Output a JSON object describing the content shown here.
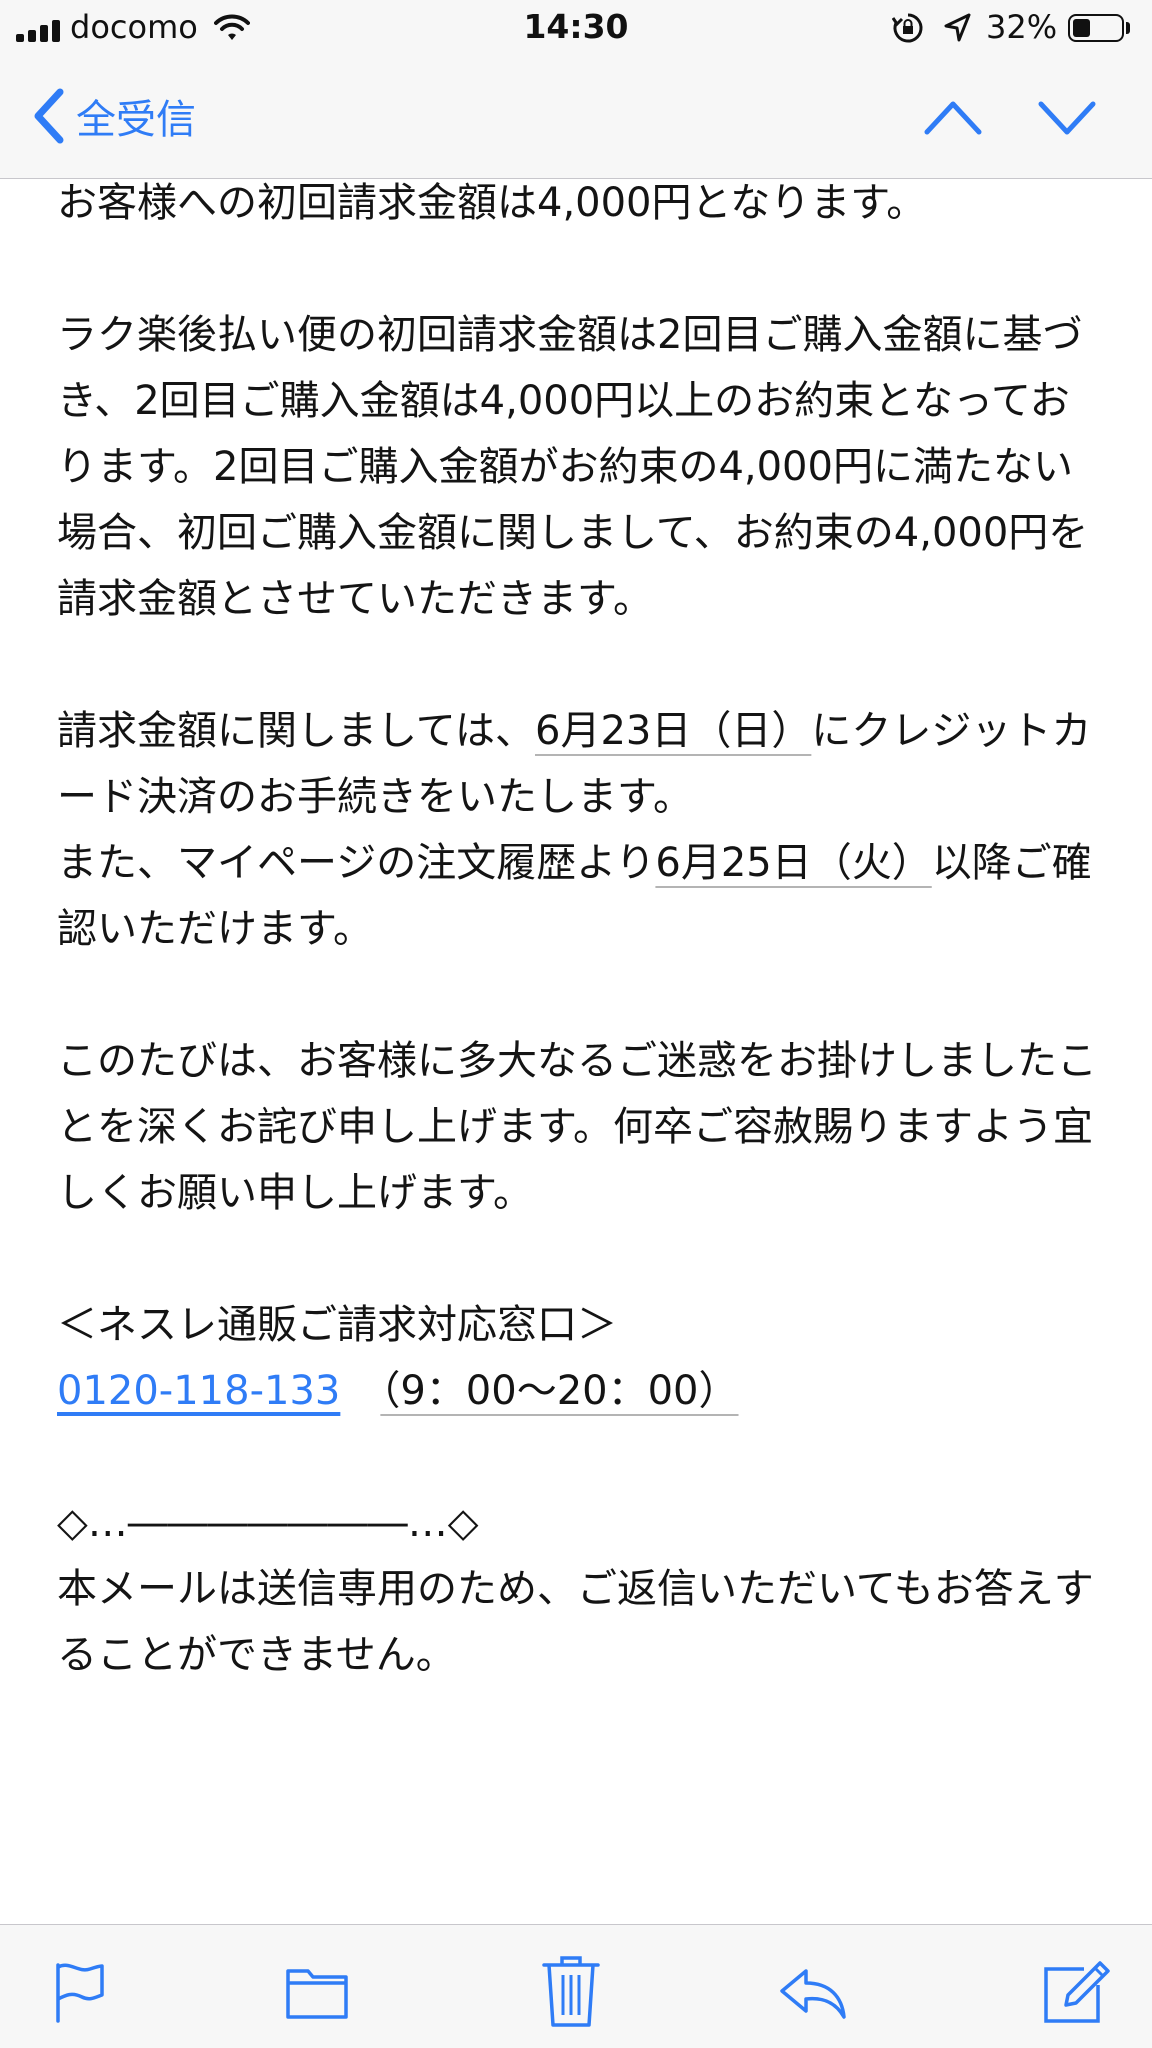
{
  "status_bar": {
    "carrier": "docomo",
    "time": "14:30",
    "battery": "32%",
    "battery_level": 0.32
  },
  "nav": {
    "back_label": "全受信"
  },
  "body": {
    "p1": "お客様への初回請求金額は4,000円となります。",
    "p2": "ラク楽後払い便の初回請求金額は2回目ご購入金額に基づき、2回目ご購入金額は4,000円以上のお約束となっております。2回目ご購入金額がお約束の4,000円に満たない場合、初回ご購入金額に関しまして、お約束の4,000円を請求金額とさせていただきます。",
    "p3_pre": "請求金額に関しましては、",
    "p3_date1": "6月23日（日）",
    "p3_mid": "にクレジットカード決済のお手続きをいたします。",
    "p3_mid2": "また、マイページの注文履歴より",
    "p3_date2": "6月25日（火）",
    "p3_post": "以降ご確認いただけます。",
    "p4": "このたびは、お客様に多大なるご迷惑をお掛けしましたことを深くお詫び申し上げます。何卒ご容赦賜りますよう宜しくお願い申し上げます。",
    "contact_title": "＜ネスレ通販ご請求対応窓口＞",
    "phone": "0120-118-133",
    "hours": "（9：00～20：00）",
    "divider": "◇…―――――――…◇",
    "footer": "本メールは送信専用のため、ご返信いただいてもお答えすることができません。"
  },
  "toolbar": {
    "icons": [
      "flag-icon",
      "folder-icon",
      "trash-icon",
      "reply-icon",
      "compose-icon"
    ]
  },
  "colors": {
    "accent": "#2f7cf6",
    "bar_bg": "#f7f7f7",
    "text": "#141414"
  }
}
